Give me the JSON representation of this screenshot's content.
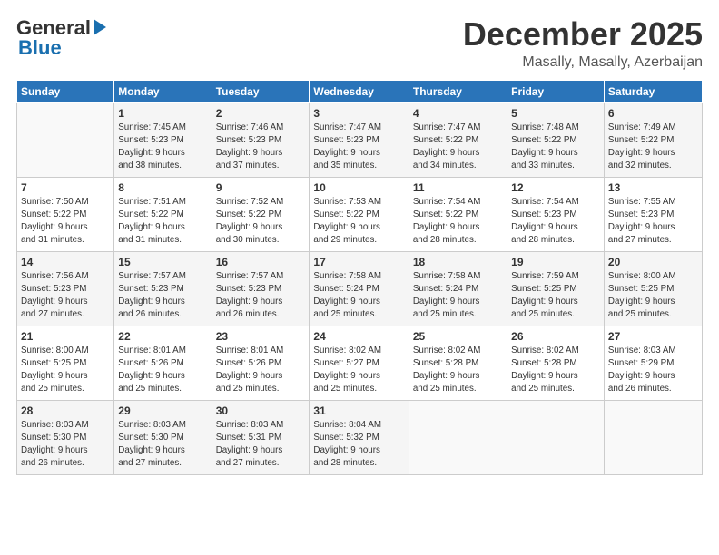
{
  "header": {
    "logo": {
      "general": "General",
      "blue": "Blue",
      "arrow": "▶"
    },
    "title": "December 2025",
    "location": "Masally, Masally, Azerbaijan"
  },
  "weekdays": [
    "Sunday",
    "Monday",
    "Tuesday",
    "Wednesday",
    "Thursday",
    "Friday",
    "Saturday"
  ],
  "weeks": [
    [
      {
        "day": "",
        "info": ""
      },
      {
        "day": "1",
        "info": "Sunrise: 7:45 AM\nSunset: 5:23 PM\nDaylight: 9 hours\nand 38 minutes."
      },
      {
        "day": "2",
        "info": "Sunrise: 7:46 AM\nSunset: 5:23 PM\nDaylight: 9 hours\nand 37 minutes."
      },
      {
        "day": "3",
        "info": "Sunrise: 7:47 AM\nSunset: 5:23 PM\nDaylight: 9 hours\nand 35 minutes."
      },
      {
        "day": "4",
        "info": "Sunrise: 7:47 AM\nSunset: 5:22 PM\nDaylight: 9 hours\nand 34 minutes."
      },
      {
        "day": "5",
        "info": "Sunrise: 7:48 AM\nSunset: 5:22 PM\nDaylight: 9 hours\nand 33 minutes."
      },
      {
        "day": "6",
        "info": "Sunrise: 7:49 AM\nSunset: 5:22 PM\nDaylight: 9 hours\nand 32 minutes."
      }
    ],
    [
      {
        "day": "7",
        "info": "Sunrise: 7:50 AM\nSunset: 5:22 PM\nDaylight: 9 hours\nand 31 minutes."
      },
      {
        "day": "8",
        "info": "Sunrise: 7:51 AM\nSunset: 5:22 PM\nDaylight: 9 hours\nand 31 minutes."
      },
      {
        "day": "9",
        "info": "Sunrise: 7:52 AM\nSunset: 5:22 PM\nDaylight: 9 hours\nand 30 minutes."
      },
      {
        "day": "10",
        "info": "Sunrise: 7:53 AM\nSunset: 5:22 PM\nDaylight: 9 hours\nand 29 minutes."
      },
      {
        "day": "11",
        "info": "Sunrise: 7:54 AM\nSunset: 5:22 PM\nDaylight: 9 hours\nand 28 minutes."
      },
      {
        "day": "12",
        "info": "Sunrise: 7:54 AM\nSunset: 5:23 PM\nDaylight: 9 hours\nand 28 minutes."
      },
      {
        "day": "13",
        "info": "Sunrise: 7:55 AM\nSunset: 5:23 PM\nDaylight: 9 hours\nand 27 minutes."
      }
    ],
    [
      {
        "day": "14",
        "info": "Sunrise: 7:56 AM\nSunset: 5:23 PM\nDaylight: 9 hours\nand 27 minutes."
      },
      {
        "day": "15",
        "info": "Sunrise: 7:57 AM\nSunset: 5:23 PM\nDaylight: 9 hours\nand 26 minutes."
      },
      {
        "day": "16",
        "info": "Sunrise: 7:57 AM\nSunset: 5:23 PM\nDaylight: 9 hours\nand 26 minutes."
      },
      {
        "day": "17",
        "info": "Sunrise: 7:58 AM\nSunset: 5:24 PM\nDaylight: 9 hours\nand 25 minutes."
      },
      {
        "day": "18",
        "info": "Sunrise: 7:58 AM\nSunset: 5:24 PM\nDaylight: 9 hours\nand 25 minutes."
      },
      {
        "day": "19",
        "info": "Sunrise: 7:59 AM\nSunset: 5:25 PM\nDaylight: 9 hours\nand 25 minutes."
      },
      {
        "day": "20",
        "info": "Sunrise: 8:00 AM\nSunset: 5:25 PM\nDaylight: 9 hours\nand 25 minutes."
      }
    ],
    [
      {
        "day": "21",
        "info": "Sunrise: 8:00 AM\nSunset: 5:25 PM\nDaylight: 9 hours\nand 25 minutes."
      },
      {
        "day": "22",
        "info": "Sunrise: 8:01 AM\nSunset: 5:26 PM\nDaylight: 9 hours\nand 25 minutes."
      },
      {
        "day": "23",
        "info": "Sunrise: 8:01 AM\nSunset: 5:26 PM\nDaylight: 9 hours\nand 25 minutes."
      },
      {
        "day": "24",
        "info": "Sunrise: 8:02 AM\nSunset: 5:27 PM\nDaylight: 9 hours\nand 25 minutes."
      },
      {
        "day": "25",
        "info": "Sunrise: 8:02 AM\nSunset: 5:28 PM\nDaylight: 9 hours\nand 25 minutes."
      },
      {
        "day": "26",
        "info": "Sunrise: 8:02 AM\nSunset: 5:28 PM\nDaylight: 9 hours\nand 25 minutes."
      },
      {
        "day": "27",
        "info": "Sunrise: 8:03 AM\nSunset: 5:29 PM\nDaylight: 9 hours\nand 26 minutes."
      }
    ],
    [
      {
        "day": "28",
        "info": "Sunrise: 8:03 AM\nSunset: 5:30 PM\nDaylight: 9 hours\nand 26 minutes."
      },
      {
        "day": "29",
        "info": "Sunrise: 8:03 AM\nSunset: 5:30 PM\nDaylight: 9 hours\nand 27 minutes."
      },
      {
        "day": "30",
        "info": "Sunrise: 8:03 AM\nSunset: 5:31 PM\nDaylight: 9 hours\nand 27 minutes."
      },
      {
        "day": "31",
        "info": "Sunrise: 8:04 AM\nSunset: 5:32 PM\nDaylight: 9 hours\nand 28 minutes."
      },
      {
        "day": "",
        "info": ""
      },
      {
        "day": "",
        "info": ""
      },
      {
        "day": "",
        "info": ""
      }
    ]
  ]
}
